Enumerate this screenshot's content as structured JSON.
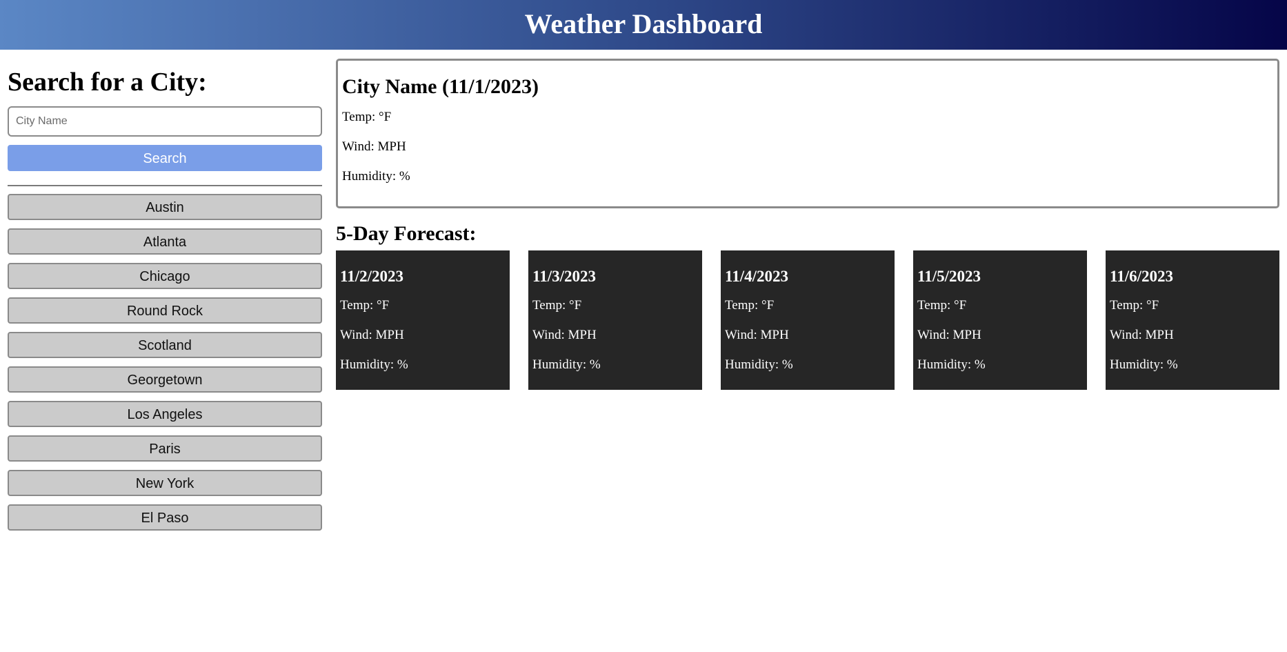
{
  "header": {
    "title": "Weather Dashboard",
    "gradient": [
      "#5b87c5",
      "#050548"
    ]
  },
  "sidebar": {
    "heading": "Search for a City:",
    "search_placeholder": "City Name",
    "search_button": "Search",
    "search_button_color": "#7a9ee8",
    "history": [
      "Austin",
      "Atlanta",
      "Chicago",
      "Round Rock",
      "Scotland",
      "Georgetown",
      "Los Angeles",
      "Paris",
      "New York",
      "El Paso"
    ]
  },
  "current": {
    "title": "City Name (11/1/2023)",
    "temp": "Temp: °F",
    "wind": "Wind: MPH",
    "humidity": "Humidity: %"
  },
  "forecast": {
    "title": "5-Day Forecast:",
    "card_color": "#262626",
    "days": [
      {
        "date": "11/2/2023",
        "temp": "Temp: °F",
        "wind": "Wind: MPH",
        "humidity": "Humidity: %"
      },
      {
        "date": "11/3/2023",
        "temp": "Temp: °F",
        "wind": "Wind: MPH",
        "humidity": "Humidity: %"
      },
      {
        "date": "11/4/2023",
        "temp": "Temp: °F",
        "wind": "Wind: MPH",
        "humidity": "Humidity: %"
      },
      {
        "date": "11/5/2023",
        "temp": "Temp: °F",
        "wind": "Wind: MPH",
        "humidity": "Humidity: %"
      },
      {
        "date": "11/6/2023",
        "temp": "Temp: °F",
        "wind": "Wind: MPH",
        "humidity": "Humidity: %"
      }
    ]
  }
}
